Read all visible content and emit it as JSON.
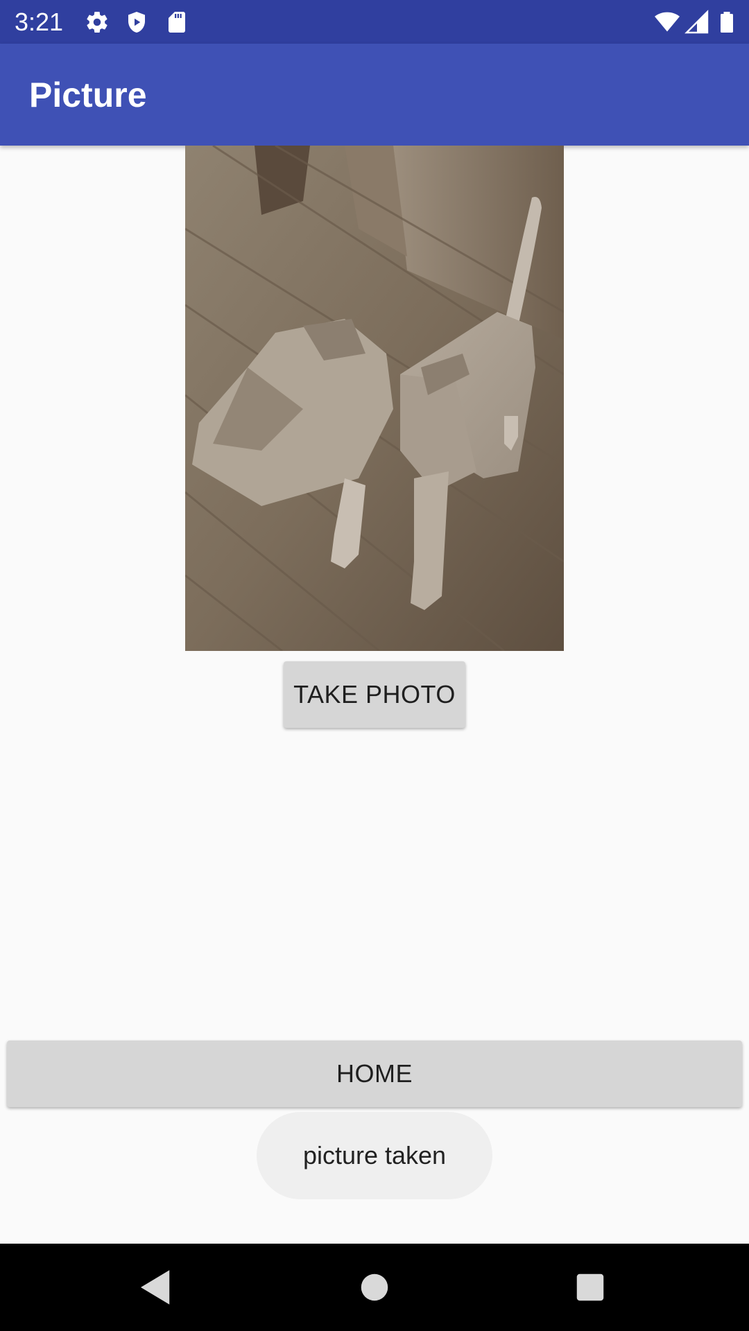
{
  "status_bar": {
    "time": "3:21",
    "icons": [
      "settings-gear-icon",
      "shield-icon",
      "sd-card-icon",
      "wifi-icon",
      "signal-icon",
      "battery-icon"
    ]
  },
  "app_bar": {
    "title": "Picture"
  },
  "photo": {
    "description_icon": "captured-photo"
  },
  "buttons": {
    "take_photo": "TAKE PHOTO",
    "home": "HOME"
  },
  "toast": {
    "message": "picture taken"
  },
  "nav_bar": {
    "icons": [
      "back-icon",
      "home-icon",
      "recents-icon"
    ]
  },
  "colors": {
    "status_bar": "#303f9f",
    "app_bar": "#3f51b5",
    "button": "#d6d6d6",
    "background": "#fafafa",
    "toast": "#efefef"
  }
}
